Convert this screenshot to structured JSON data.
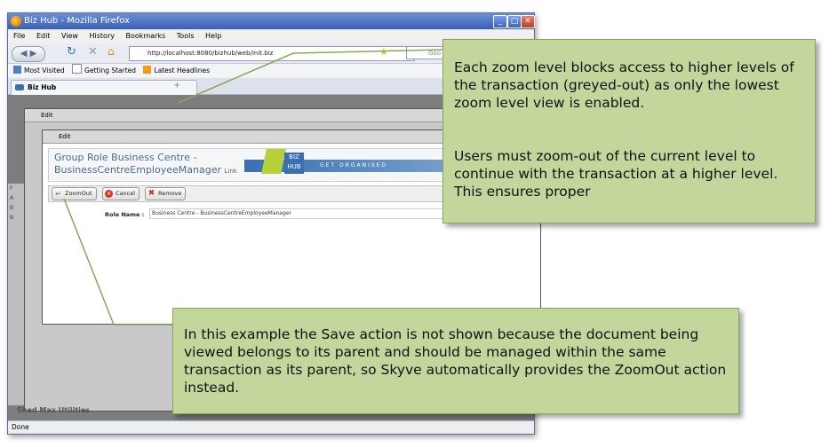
{
  "window": {
    "title": "Biz Hub - Mozilla Firefox",
    "menu": [
      "File",
      "Edit",
      "View",
      "History",
      "Bookmarks",
      "Tools",
      "Help"
    ],
    "url": "http://localhost:8080/bizhub/web/init.biz",
    "search_hint": "Goo",
    "bookmarks": [
      "Most Visited",
      "Getting Started",
      "Latest Headlines"
    ],
    "tab_label": "Biz Hub",
    "new_tab": "+",
    "status": "Done"
  },
  "outer_dialog": {
    "title": "Edit"
  },
  "inner_dialog": {
    "title": "Edit",
    "header_line1": "Group Role Business Centre -",
    "header_line2": "BusinessCentreEmployeeManager",
    "header_link": "Link",
    "logo_text": "BIZ HUB",
    "logo_tagline": "GET ORGANISED",
    "toolbar": {
      "zoomout_label": "ZoomOut",
      "cancel_label": "Cancel",
      "remove_label": "Remove"
    },
    "field_label": "Role Name :",
    "field_value": "Business Centre - BusinessCentreEmployeeManager"
  },
  "sidebar_letters": [
    "F",
    "A",
    "B",
    "B"
  ],
  "bottom_label": "Shed Max Utilities",
  "callouts": {
    "zoom_levels": "Each zoom level blocks access to higher levels of the transaction (greyed-out) as only the lowest zoom level view is enabled.",
    "zoom_out": "Users must zoom-out of the current level to continue with the transaction at a higher level. This ensures proper",
    "save_note": "In this example the Save action is not shown because the document being viewed belongs to its parent and should be managed within the same transaction as its parent, so Skyve automatically provides the ZoomOut action instead."
  },
  "colors": {
    "callout_fill": "#c3d69b",
    "callout_border": "#8aa65a",
    "header_text": "#4d6b8a"
  }
}
